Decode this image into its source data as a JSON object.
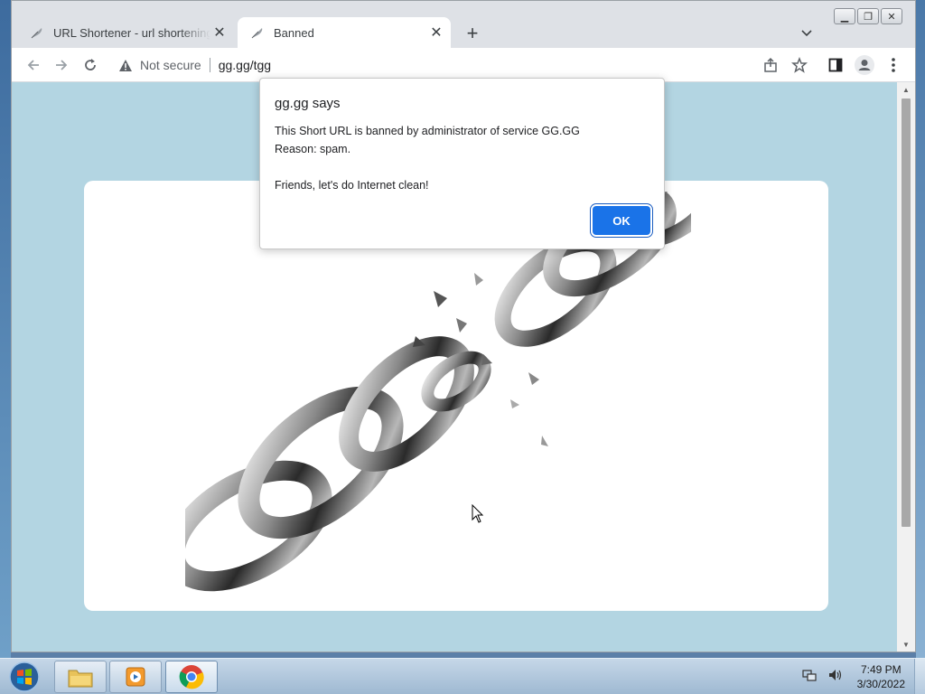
{
  "browser": {
    "tabs": [
      {
        "title": "URL Shortener - url shortening se",
        "active": false
      },
      {
        "title": "Banned",
        "active": true
      }
    ],
    "address_bar": {
      "security_label": "Not secure",
      "url": "gg.gg/tgg"
    },
    "icons": {
      "back": "arrow-left-icon",
      "forward": "arrow-right-icon",
      "reload": "reload-icon",
      "share": "share-icon",
      "bookmark": "star-icon",
      "side_panel": "side-panel-icon",
      "profile": "avatar-icon",
      "menu": "kebab-menu-icon"
    }
  },
  "dialog": {
    "title": "gg.gg says",
    "message_line_1": "This Short URL is banned by administrator of service GG.GG",
    "message_line_2": "Reason: spam.",
    "message_line_3": "Friends, let's do Internet clean!",
    "ok_label": "OK"
  },
  "page": {
    "background_color": "#b3d5e2",
    "image": "broken-chain"
  },
  "taskbar": {
    "time": "7:49 PM",
    "date": "3/30/2022",
    "pinned": [
      "windows-explorer",
      "media-player",
      "google-chrome"
    ]
  },
  "colors": {
    "accent": "#1a73e8",
    "tab_strip": "#dee1e6"
  }
}
